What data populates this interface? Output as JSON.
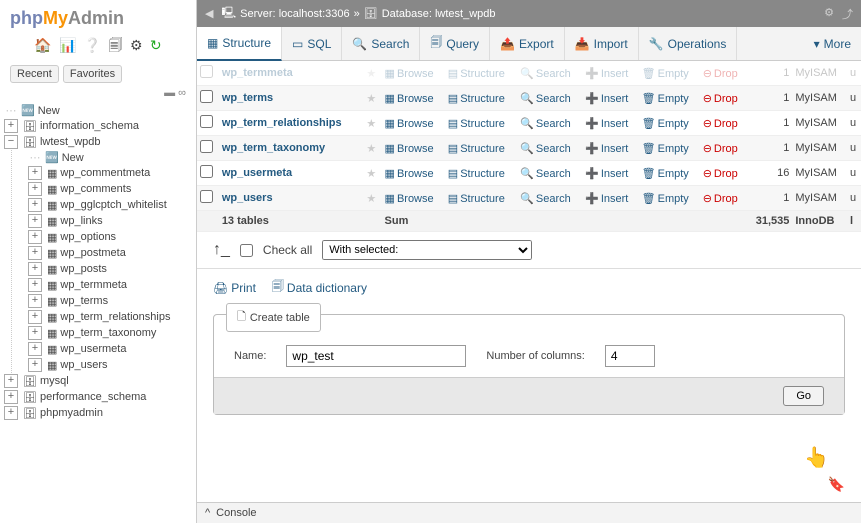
{
  "logo": {
    "php": "php",
    "my": "My",
    "admin": "Admin"
  },
  "sidebar_tabs": {
    "recent": "Recent",
    "favorites": "Favorites"
  },
  "tree": {
    "new": "New",
    "dbs": [
      {
        "name": "information_schema",
        "children": []
      },
      {
        "name": "lwtest_wpdb",
        "expanded": true,
        "children": [
          {
            "name": "New",
            "is_new": true
          },
          {
            "name": "wp_commentmeta"
          },
          {
            "name": "wp_comments"
          },
          {
            "name": "wp_gglcptch_whitelist"
          },
          {
            "name": "wp_links"
          },
          {
            "name": "wp_options"
          },
          {
            "name": "wp_postmeta"
          },
          {
            "name": "wp_posts"
          },
          {
            "name": "wp_termmeta"
          },
          {
            "name": "wp_terms"
          },
          {
            "name": "wp_term_relationships"
          },
          {
            "name": "wp_term_taxonomy"
          },
          {
            "name": "wp_usermeta"
          },
          {
            "name": "wp_users"
          }
        ]
      },
      {
        "name": "mysql",
        "children": []
      },
      {
        "name": "performance_schema",
        "children": []
      },
      {
        "name": "phpmyadmin",
        "children": []
      }
    ]
  },
  "breadcrumb": {
    "server_label": "Server:",
    "server_value": "localhost:3306",
    "db_label": "Database:",
    "db_value": "lwtest_wpdb"
  },
  "topnav": [
    {
      "label": "Structure",
      "icon": "▦"
    },
    {
      "label": "SQL",
      "icon": "▭"
    },
    {
      "label": "Search",
      "icon": "🔍"
    },
    {
      "label": "Query",
      "icon": "🗐"
    },
    {
      "label": "Export",
      "icon": "📤"
    },
    {
      "label": "Import",
      "icon": "📥"
    },
    {
      "label": "Operations",
      "icon": "🔧"
    }
  ],
  "topnav_more": "More",
  "actions": {
    "browse": "Browse",
    "structure": "Structure",
    "search": "Search",
    "insert": "Insert",
    "empty": "Empty",
    "drop": "Drop"
  },
  "rows": [
    {
      "name": "wp_terms",
      "rows": "1",
      "engine": "MyISAM",
      "coll": "u"
    },
    {
      "name": "wp_term_relationships",
      "rows": "1",
      "engine": "MyISAM",
      "coll": "u"
    },
    {
      "name": "wp_term_taxonomy",
      "rows": "1",
      "engine": "MyISAM",
      "coll": "u"
    },
    {
      "name": "wp_usermeta",
      "rows": "16",
      "engine": "MyISAM",
      "coll": "u"
    },
    {
      "name": "wp_users",
      "rows": "1",
      "engine": "MyISAM",
      "coll": "u"
    }
  ],
  "sum": {
    "label": "13 tables",
    "sumlabel": "Sum",
    "total": "31,535",
    "engine": "InnoDB",
    "coll": "l"
  },
  "checkall": {
    "label": "Check all",
    "placeholder": "With selected:"
  },
  "tools": {
    "print": "Print",
    "dict": "Data dictionary"
  },
  "create": {
    "legend": "Create table",
    "name_label": "Name:",
    "name_value": "wp_test",
    "cols_label": "Number of columns:",
    "cols_value": "4",
    "go": "Go"
  },
  "console": "Console"
}
